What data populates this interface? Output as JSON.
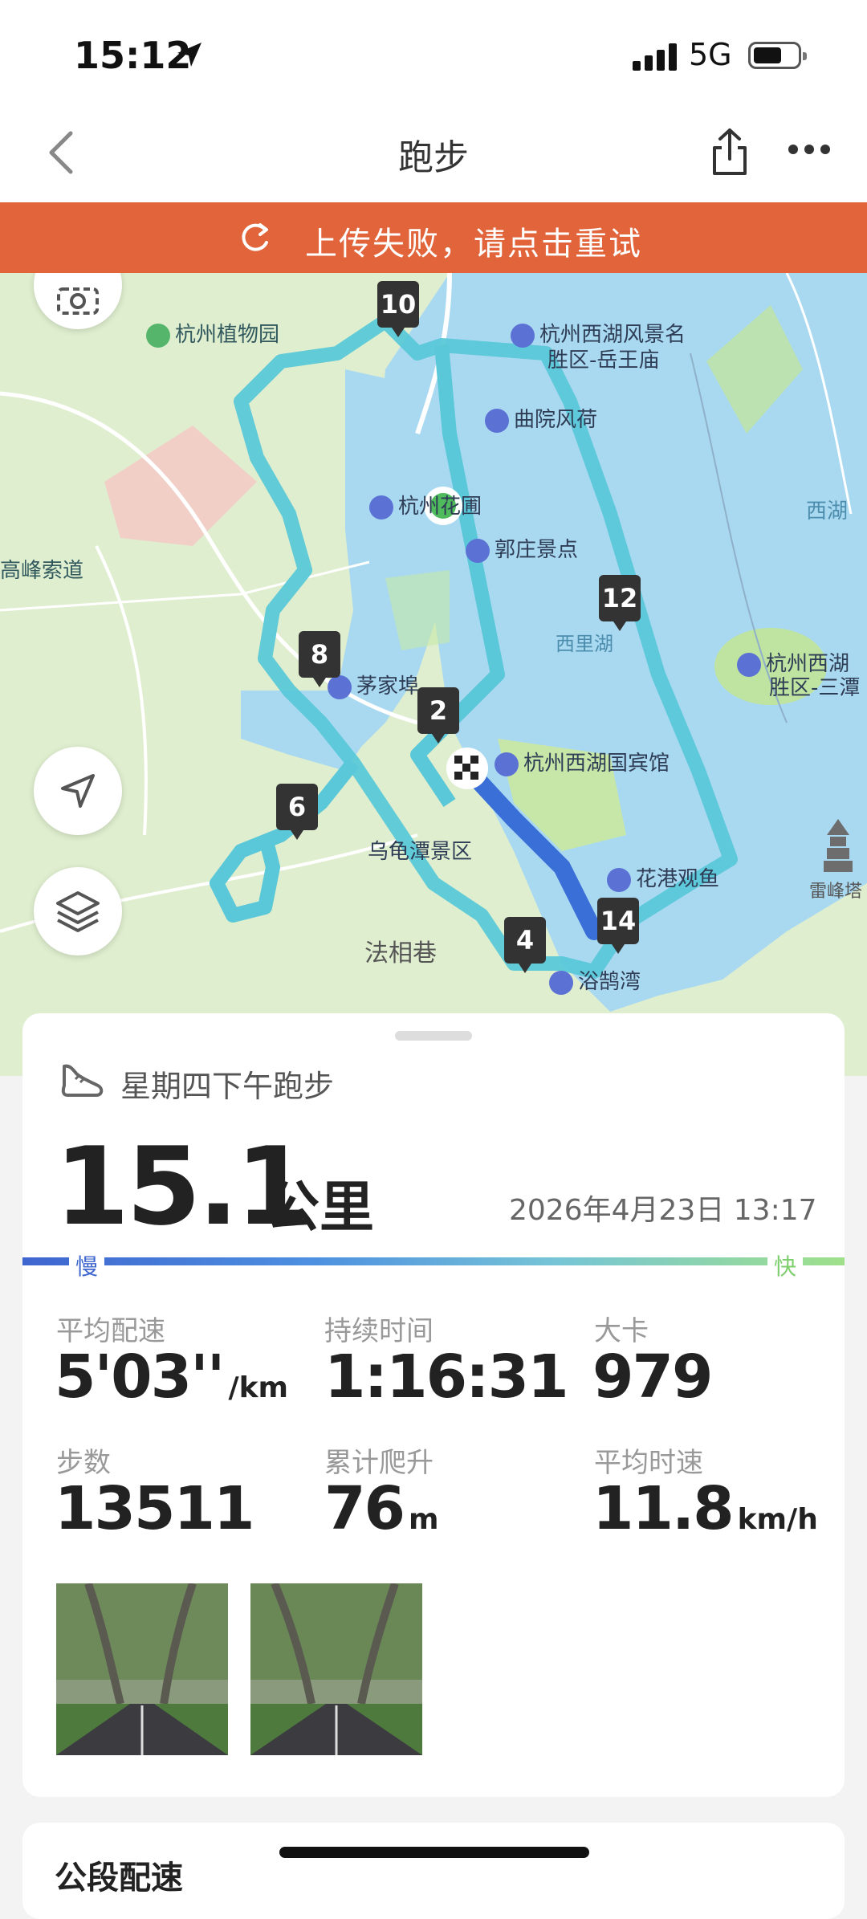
{
  "status_bar": {
    "time": "15:12",
    "network": "5G"
  },
  "nav": {
    "title": "跑步",
    "back_icon": "chevron-left-icon",
    "share_icon": "share-icon",
    "more_icon": "more-icon"
  },
  "banner": {
    "text": "上传失败，请点击重试",
    "color": "#e2643a",
    "icon": "retry-icon"
  },
  "map": {
    "labels": {
      "botanical": "杭州植物园",
      "yuewang": "杭州西湖风景名",
      "yuewang2": "胜区-岳王庙",
      "quyuan": "曲院风荷",
      "hangzhou_garden": "杭州花圃",
      "guozhuang": "郭庄景点",
      "xihu": "西湖",
      "gaofeng": "高峰索道",
      "xilihu": "西里湖",
      "santan": "杭州西湖",
      "santan2": "胜区-三潭",
      "maojiabu": "茅家埠",
      "state_guesthouse": "杭州西湖国宾馆",
      "wuguitan": "乌龟潭景区",
      "huagang": "花港观鱼",
      "leifeng": "雷峰塔",
      "faxiang": "法相巷",
      "yuhuwan": "浴鹄湾"
    },
    "km_markers": [
      "10",
      "12",
      "8",
      "2",
      "6",
      "4",
      "14"
    ],
    "route_color": "#5ac8d8",
    "fast_segment_color": "#3a6fd8"
  },
  "activity": {
    "title": "星期四下午跑步",
    "distance": "15.1",
    "distance_unit": "公里",
    "datetime": "2026年4月23日 13:17",
    "slow_label": "慢",
    "fast_label": "快"
  },
  "stats": {
    "avg_pace": {
      "label": "平均配速",
      "value": "5'03''",
      "unit": "/km"
    },
    "duration": {
      "label": "持续时间",
      "value": "1:16:31"
    },
    "calories": {
      "label": "大卡",
      "value": "979"
    },
    "steps": {
      "label": "步数",
      "value": "13511"
    },
    "elevation": {
      "label": "累计爬升",
      "value": "76",
      "unit": "m"
    },
    "avg_speed": {
      "label": "平均时速",
      "value": "11.8",
      "unit": "km/h"
    }
  },
  "section2": {
    "title": "公段配速"
  }
}
